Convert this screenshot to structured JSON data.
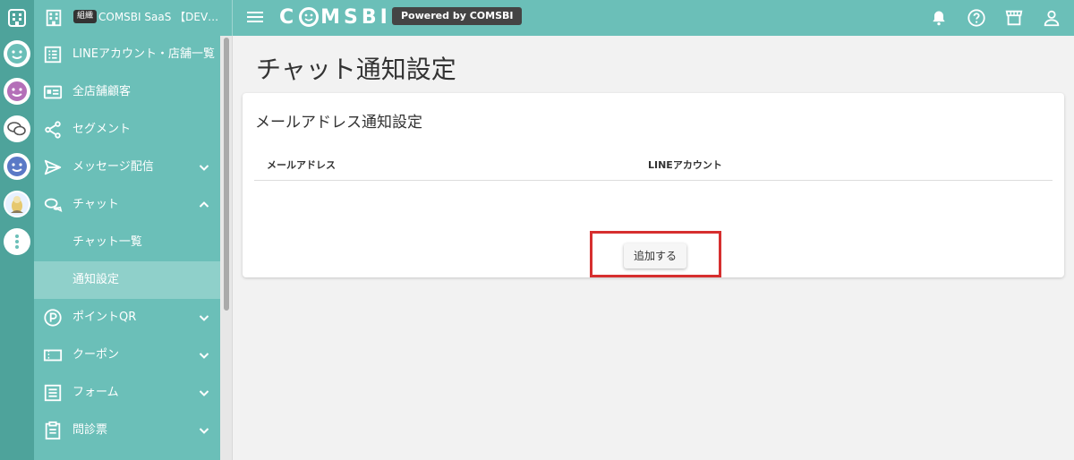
{
  "header": {
    "org_tag": "組織",
    "org_name": "COMSBI SaaS 【DEV】...",
    "logo_text_left": "C",
    "logo_text_right": "MSBI",
    "powered_by": "Powered by COMSBI",
    "icons": [
      "bell-icon",
      "help-icon",
      "store-icon",
      "user-icon"
    ]
  },
  "rail": {
    "items": [
      "smiley-teal-icon",
      "smiley-purple-icon",
      "chat-bubbles-icon",
      "smiley-blue-icon",
      "character-icon",
      "more-icon"
    ]
  },
  "sidebar": {
    "items": [
      {
        "label": "LINEアカウント・店舗一覧",
        "icon": "list-icon"
      },
      {
        "label": "全店舗顧客",
        "icon": "id-card-icon"
      },
      {
        "label": "セグメント",
        "icon": "share-icon"
      },
      {
        "label": "メッセージ配信",
        "icon": "send-icon",
        "chevron": "down"
      },
      {
        "label": "チャット",
        "icon": "chat-icon",
        "chevron": "up"
      },
      {
        "label": "チャット一覧"
      },
      {
        "label": "通知設定",
        "active": true
      },
      {
        "label": "ポイントQR",
        "icon": "point-icon",
        "chevron": "down"
      },
      {
        "label": "クーポン",
        "icon": "coupon-icon",
        "chevron": "down"
      },
      {
        "label": "フォーム",
        "icon": "form-icon",
        "chevron": "down"
      },
      {
        "label": "問診票",
        "icon": "clipboard-icon",
        "chevron": "down"
      }
    ]
  },
  "main": {
    "page_title": "チャット通知設定",
    "card": {
      "title": "メールアドレス通知設定",
      "columns": [
        "メールアドレス",
        "LINEアカウント"
      ],
      "add_button": "追加する"
    }
  },
  "colors": {
    "accent": "#6bbfb8",
    "rail": "#4ea39b",
    "active_item": "#8fd0ca",
    "highlight": "#d62f2f"
  }
}
